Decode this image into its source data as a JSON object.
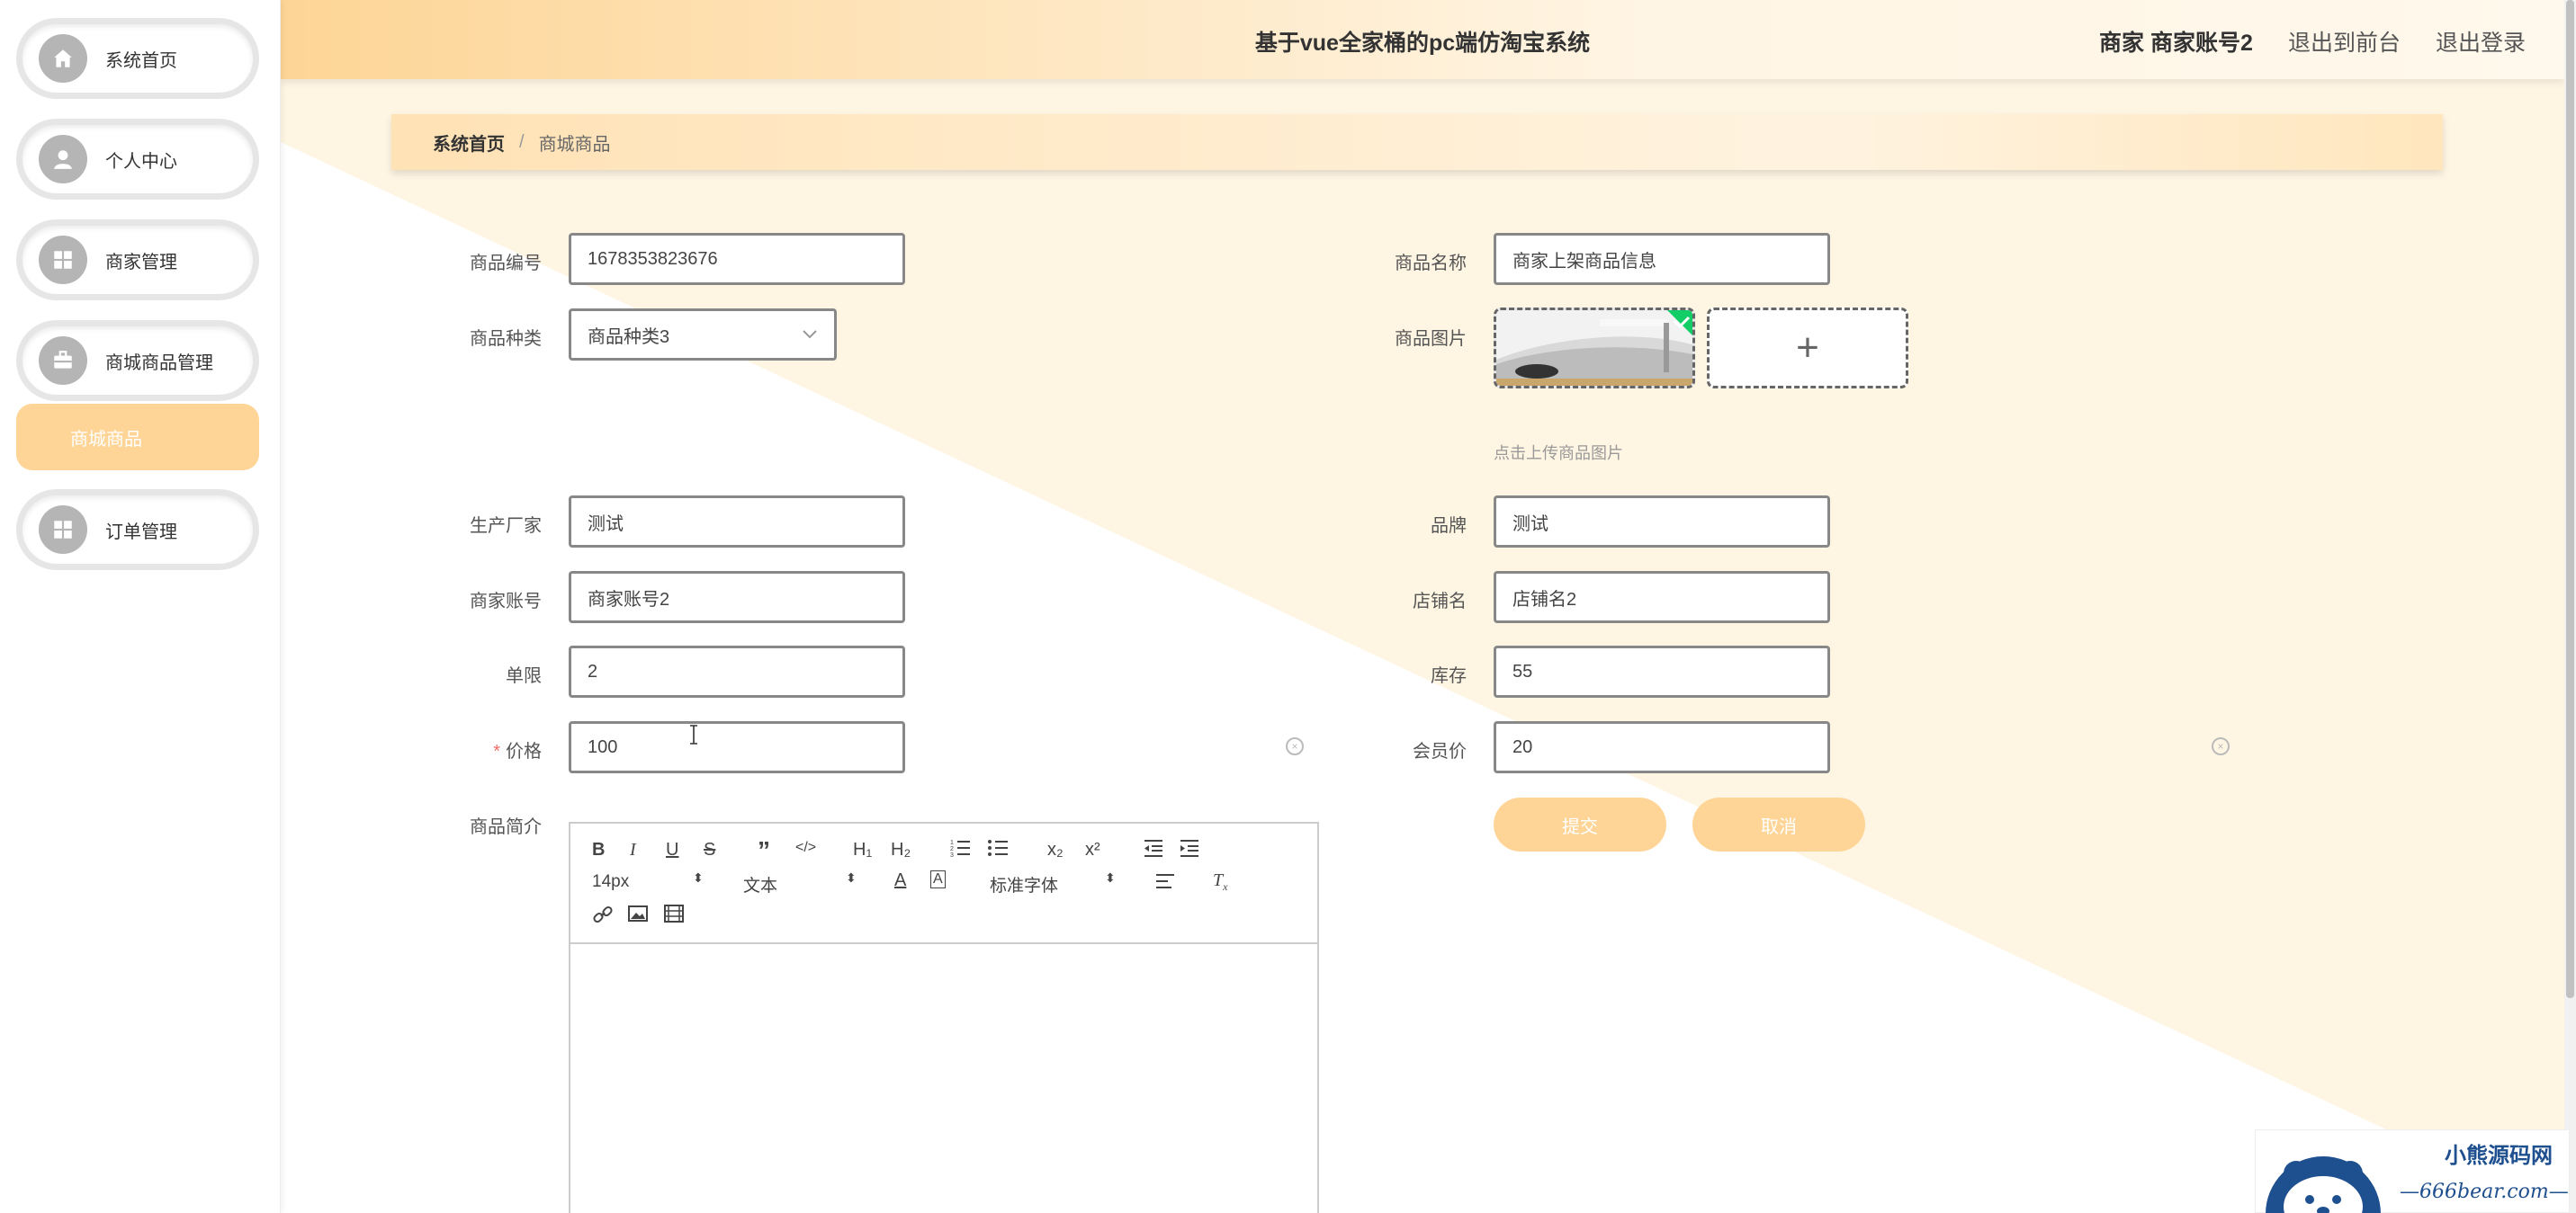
{
  "sidebar": {
    "items": [
      {
        "label": "系统首页",
        "icon": "home-icon"
      },
      {
        "label": "个人中心",
        "icon": "user-icon"
      },
      {
        "label": "商家管理",
        "icon": "grid-icon"
      },
      {
        "label": "商城商品管理",
        "icon": "briefcase-icon"
      },
      {
        "label": "订单管理",
        "icon": "grid-icon"
      }
    ],
    "sub_active": "商城商品"
  },
  "header": {
    "title": "基于vue全家桶的pc端仿淘宝系统",
    "user": "商家 商家账号2",
    "front": "退出到前台",
    "logout": "退出登录"
  },
  "breadcrumb": {
    "home": "系统首页",
    "sep": "/",
    "current": "商城商品"
  },
  "form": {
    "code_label": "商品编号",
    "code_value": "1678353823676",
    "name_label": "商品名称",
    "name_value": "商家上架商品信息",
    "category_label": "商品种类",
    "category_value": "商品种类3",
    "image_label": "商品图片",
    "image_hint": "点击上传商品图片",
    "maker_label": "生产厂家",
    "maker_value": "测试",
    "brand_label": "品牌",
    "brand_value": "测试",
    "account_label": "商家账号",
    "account_value": "商家账号2",
    "shop_label": "店铺名",
    "shop_value": "店铺名2",
    "limit_label": "单限",
    "limit_value": "2",
    "stock_label": "库存",
    "stock_value": "55",
    "price_req": "*",
    "price_label": "价格",
    "price_value": "100",
    "member_label": "会员价",
    "member_value": "20",
    "intro_label": "商品简介",
    "submit": "提交",
    "cancel": "取消"
  },
  "editor": {
    "font_size": "14px",
    "block": "文本",
    "font_family": "标准字体"
  },
  "colors": {
    "accent": "#ffd597",
    "header_left": "#fdd596",
    "bg_tri": "#fff5e3"
  }
}
